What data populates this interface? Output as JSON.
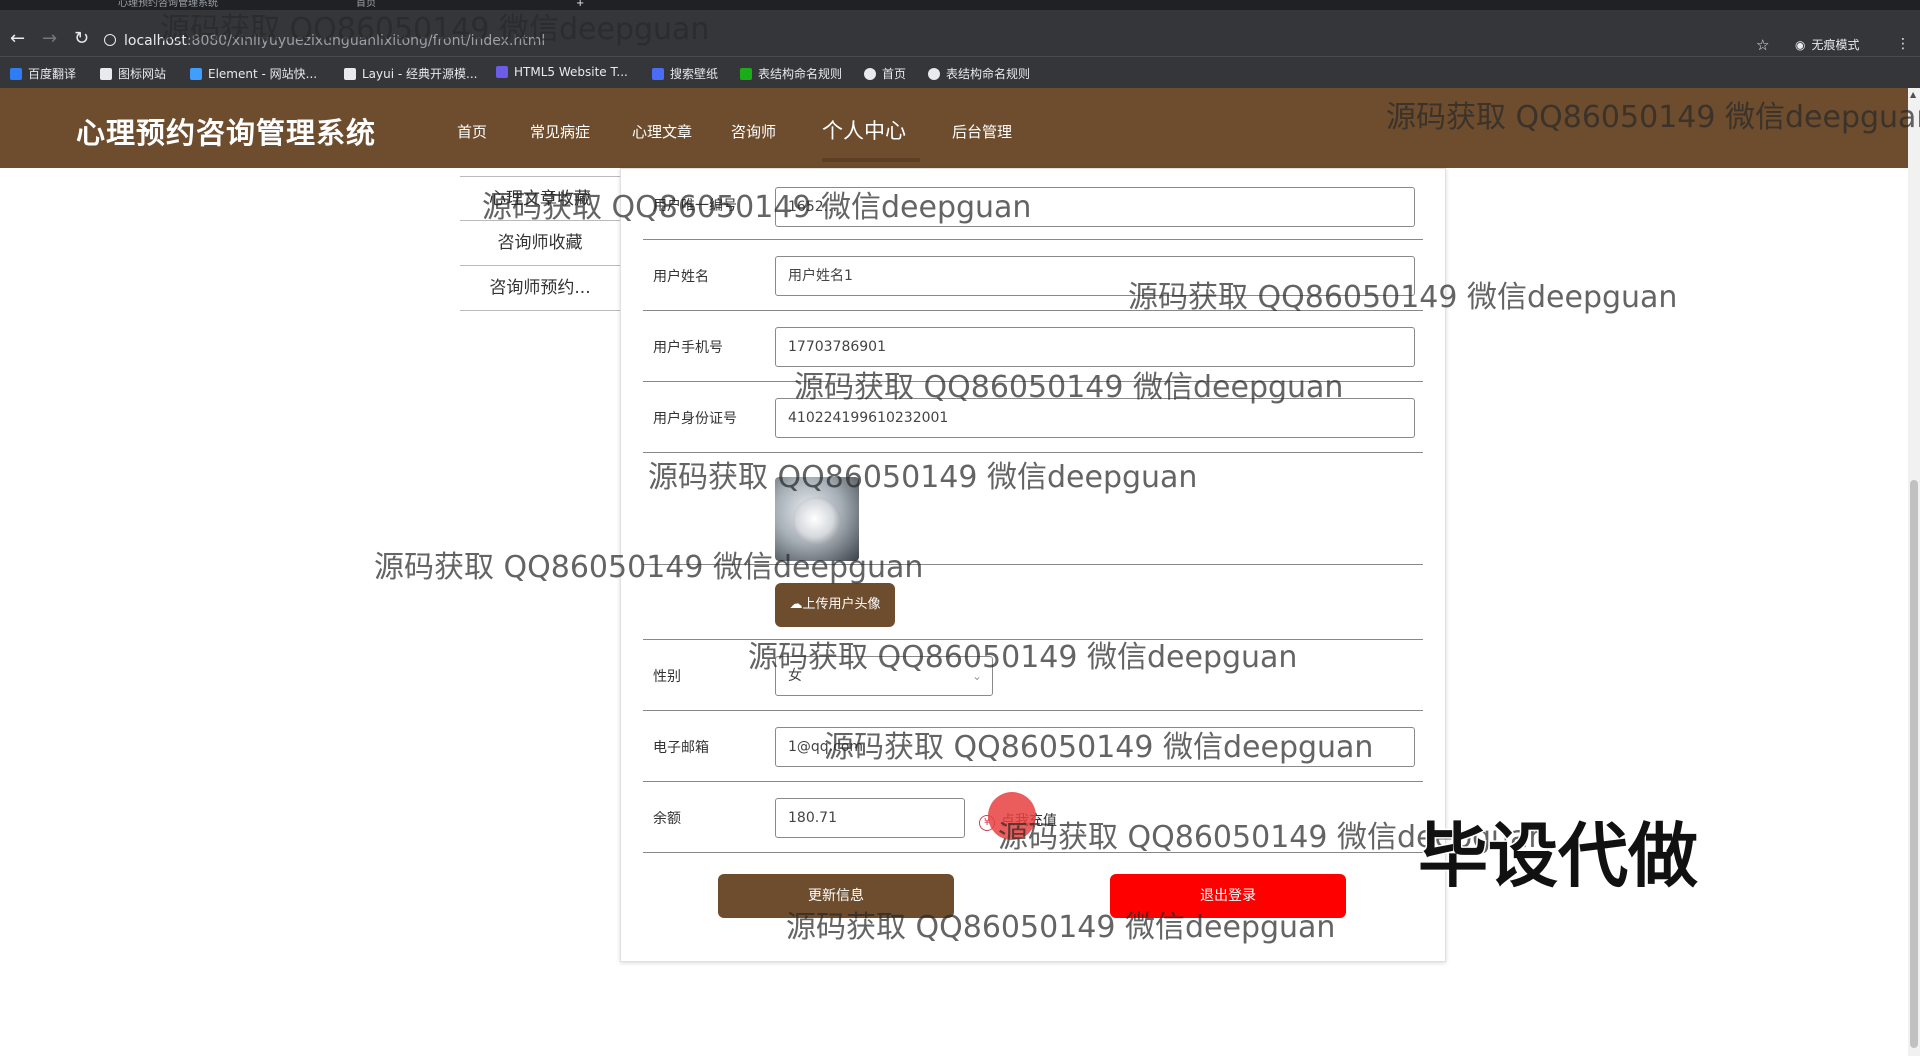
{
  "browser": {
    "tabs": [
      {
        "title": "心理预约咨询管理系统"
      },
      {
        "title": "首页"
      }
    ],
    "url_host": "localhost",
    "url_path": ":8080/xinliyuyuezixunguanlixitong/front/index.html",
    "incognito_label": "无痕模式",
    "bookmarks": [
      {
        "label": "百度翻译",
        "color": "#2f7df6"
      },
      {
        "label": "图标网站",
        "color": "#e8eaed"
      },
      {
        "label": "Element - 网站快...",
        "color": "#409eff"
      },
      {
        "label": "Layui - 经典开源模...",
        "color": "#e8eaed"
      },
      {
        "label": "HTML5 Website T...",
        "color": "#6c5ce7"
      },
      {
        "label": "搜索壁纸",
        "color": "#4a6cf7"
      },
      {
        "label": "表结构命名规则",
        "color": "#1aad19"
      },
      {
        "label": "首页",
        "color": "#e8eaed"
      },
      {
        "label": "表结构命名规则",
        "color": "#e8eaed"
      }
    ]
  },
  "header": {
    "site_title": "心理预约咨询管理系统",
    "nav": [
      "首页",
      "常见病症",
      "心理文章",
      "咨询师",
      "个人中心",
      "后台管理"
    ],
    "active_nav": "个人中心",
    "brand_color": "#6d4d2e"
  },
  "side_menu": [
    "心理文章收藏",
    "咨询师收藏",
    "咨询师预约..."
  ],
  "form": {
    "user_id": {
      "label": "用户唯一编号",
      "value": "1652..."
    },
    "user_name": {
      "label": "用户姓名",
      "value": "用户姓名1"
    },
    "phone": {
      "label": "用户手机号",
      "value": "17703786901"
    },
    "id_card": {
      "label": "用户身份证号",
      "value": "410224199610232001"
    },
    "upload_label": "上传用户头像",
    "gender": {
      "label": "性别",
      "value": "女"
    },
    "email": {
      "label": "电子邮箱",
      "value": "1@qq.com"
    },
    "balance": {
      "label": "余额",
      "value": "180.71",
      "recharge_label": "点我充值"
    },
    "update_button": "更新信息",
    "logout_button": "退出登录",
    "logout_color": "#ff0000"
  },
  "watermark_text": "源码获取 QQ86050149 微信deepguan",
  "promo_text": "毕设代做"
}
